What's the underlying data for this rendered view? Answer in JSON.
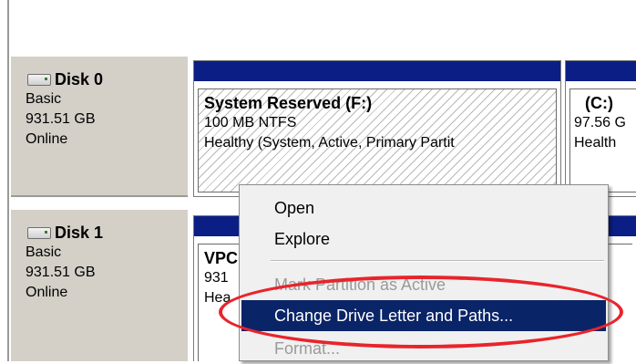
{
  "disks": [
    {
      "title": "Disk 0",
      "type": "Basic",
      "size": "931.51 GB",
      "status": "Online",
      "icon": "disk-icon"
    },
    {
      "title": "Disk 1",
      "type": "Basic",
      "size": "931.51 GB",
      "status": "Online",
      "icon": "disk-icon"
    }
  ],
  "volumes": {
    "disk0_primary": {
      "name": "System Reserved  (F:)",
      "line1": "100 MB NTFS",
      "line2": "Healthy (System, Active, Primary Partit"
    },
    "disk0_secondary": {
      "name": "(C:)",
      "line1": "97.56 G",
      "line2": "Health"
    },
    "disk1_primary": {
      "name": "VPC",
      "line1": "931",
      "line2": "Hea"
    }
  },
  "context_menu": {
    "items": [
      {
        "label": "Open",
        "state": "enabled"
      },
      {
        "label": "Explore",
        "state": "enabled"
      },
      {
        "label": "Mark Partition as Active",
        "state": "disabled"
      },
      {
        "label": "Change Drive Letter and Paths...",
        "state": "selected"
      },
      {
        "label": "Format...",
        "state": "disabled"
      }
    ]
  },
  "colors": {
    "volume_header": "#0a1e86",
    "selection": "#0a2468",
    "highlight_ellipse": "#e8242b",
    "panel": "#d4d0c8"
  }
}
